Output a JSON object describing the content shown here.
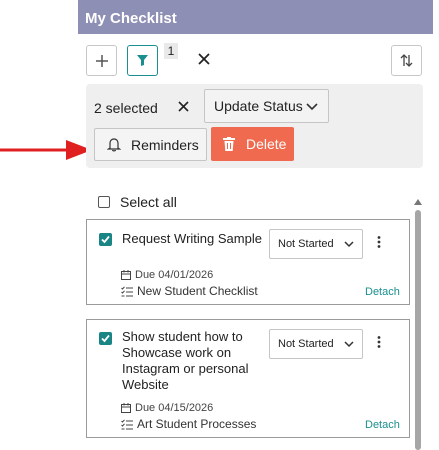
{
  "header": {
    "title": "My Checklist"
  },
  "toolbar": {
    "filter_count": "1"
  },
  "selection": {
    "count_label": "2 selected",
    "update_status_label": "Update Status",
    "reminders_label": "Reminders",
    "delete_label": "Delete"
  },
  "list": {
    "select_all_label": "Select all",
    "items": [
      {
        "title": "Request Writing Sample",
        "status": "Not Started",
        "due": "Due 04/01/2026",
        "checklist": "New Student Checklist",
        "detach_label": "Detach"
      },
      {
        "title": "Show student how to Showcase work on Instagram or personal Website",
        "status": "Not Started",
        "due": "Due 04/15/2026",
        "checklist": "Art Student Processes",
        "detach_label": "Detach"
      }
    ]
  },
  "colors": {
    "title_bar": "#8e8fb5",
    "accent": "#1a8f8f",
    "delete": "#ef6a4f",
    "arrow": "#e02020"
  }
}
